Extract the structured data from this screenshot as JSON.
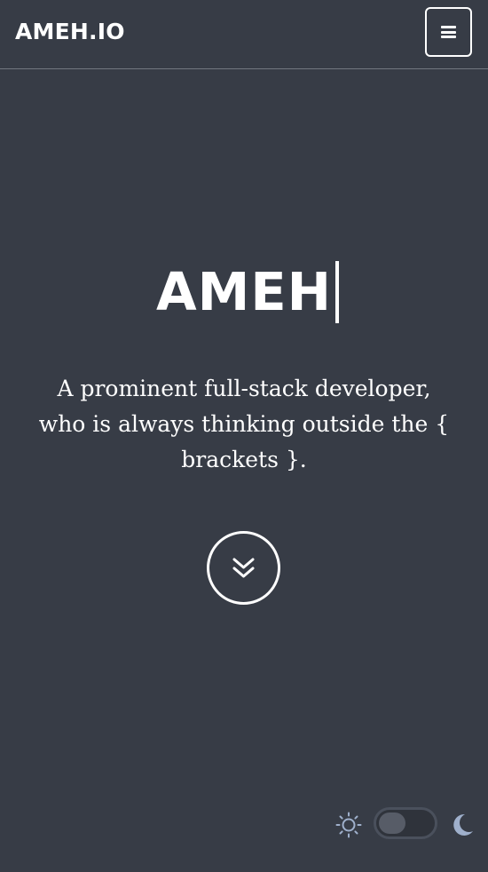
{
  "navbar": {
    "brand": "AMEH.IO",
    "menu_icon": "hamburger-icon"
  },
  "hero": {
    "title": "AMEH",
    "subtitle": "A prominent full-stack developer, who is always thinking outside the { brackets }.",
    "scroll_icon": "double-chevron-down-icon"
  },
  "theme": {
    "light_icon": "sun-icon",
    "dark_icon": "moon-icon",
    "mode": "light",
    "icon_color": "#9fb0cc"
  },
  "colors": {
    "background": "#373c46",
    "text": "#ffffff",
    "divider": "#727780"
  }
}
